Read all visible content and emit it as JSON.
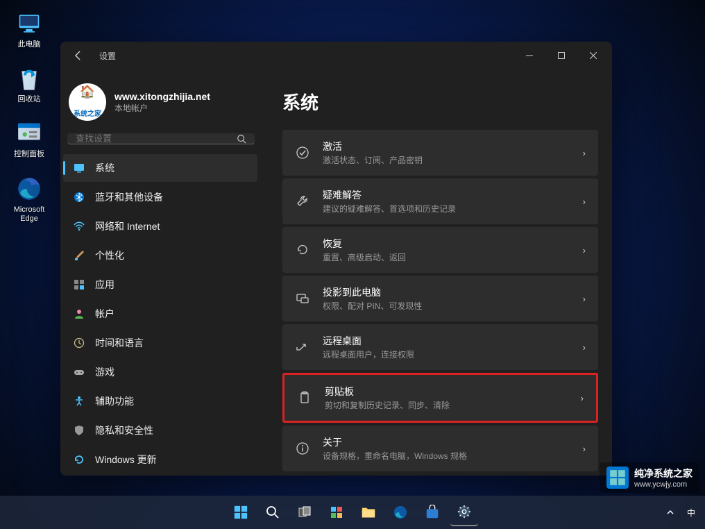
{
  "desktop": {
    "icons": [
      {
        "label": "此电脑"
      },
      {
        "label": "回收站"
      },
      {
        "label": "控制面板"
      },
      {
        "label": "Microsoft Edge"
      }
    ]
  },
  "settings": {
    "app_title": "设置",
    "user_name": "www.xitongzhijia.net",
    "user_sub": "本地帐户",
    "avatar_top": "🏠",
    "avatar_bot": "系统之家",
    "search_placeholder": "查找设置",
    "nav": [
      {
        "label": "系统"
      },
      {
        "label": "蓝牙和其他设备"
      },
      {
        "label": "网络和 Internet"
      },
      {
        "label": "个性化"
      },
      {
        "label": "应用"
      },
      {
        "label": "帐户"
      },
      {
        "label": "时间和语言"
      },
      {
        "label": "游戏"
      },
      {
        "label": "辅助功能"
      },
      {
        "label": "隐私和安全性"
      },
      {
        "label": "Windows 更新"
      }
    ],
    "page_title": "系统",
    "cards": [
      {
        "title": "激活",
        "sub": "激活状态、订阅、产品密钥"
      },
      {
        "title": "疑难解答",
        "sub": "建议的疑难解答、首选项和历史记录"
      },
      {
        "title": "恢复",
        "sub": "重置、高级启动、返回"
      },
      {
        "title": "投影到此电脑",
        "sub": "权限、配对 PIN、可发现性"
      },
      {
        "title": "远程桌面",
        "sub": "远程桌面用户，连接权限"
      },
      {
        "title": "剪贴板",
        "sub": "剪切和复制历史记录、同步、清除"
      },
      {
        "title": "关于",
        "sub": "设备规格，重命名电脑，Windows 规格"
      }
    ]
  },
  "tray": {
    "ime": "中"
  },
  "watermark": {
    "line1": "纯净系统之家",
    "line2": "www.ycwjy.com"
  }
}
